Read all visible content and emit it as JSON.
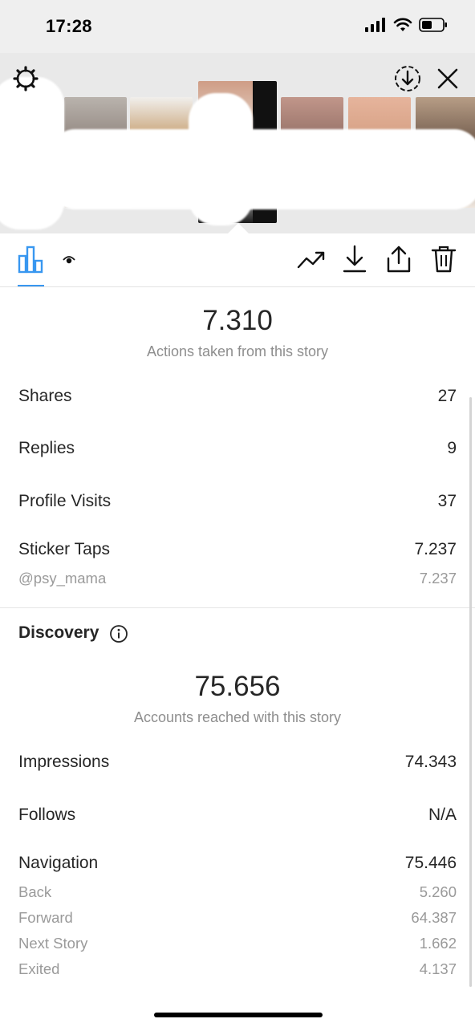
{
  "status_bar": {
    "time": "17:28",
    "icons": [
      "cellular-signal-icon",
      "wifi-icon",
      "battery-icon"
    ]
  },
  "story_strip": {
    "thumbnails": [
      "story-thumb-1",
      "story-thumb-2",
      "story-thumb-selected",
      "story-thumb-4",
      "story-thumb-5",
      "story-thumb-6"
    ],
    "settings_icon": "gear-icon",
    "download_icon": "download-circle-icon",
    "close_icon": "close-icon"
  },
  "toolbar": {
    "tabs": [
      "insights-bar-chart-icon",
      "viewers-eye-icon"
    ],
    "actions": [
      "promote-trend-icon",
      "save-download-icon",
      "share-icon",
      "delete-trash-icon"
    ],
    "accent": "#3897f0"
  },
  "interactions": {
    "total": "7.310",
    "caption": "Actions taken from this story",
    "rows": [
      {
        "label": "Shares",
        "value": "27"
      },
      {
        "label": "Replies",
        "value": "9"
      },
      {
        "label": "Profile Visits",
        "value": "37"
      },
      {
        "label": "Sticker Taps",
        "value": "7.237"
      }
    ],
    "sticker_sub": {
      "label": "@psy_mama",
      "value": "7.237"
    }
  },
  "discovery": {
    "title": "Discovery",
    "total": "75.656",
    "caption": "Accounts reached with this story",
    "rows": [
      {
        "label": "Impressions",
        "value": "74.343"
      },
      {
        "label": "Follows",
        "value": "N/A"
      },
      {
        "label": "Navigation",
        "value": "75.446"
      }
    ],
    "navigation_sub": [
      {
        "label": "Back",
        "value": "5.260"
      },
      {
        "label": "Forward",
        "value": "64.387"
      },
      {
        "label": "Next Story",
        "value": "1.662"
      },
      {
        "label": "Exited",
        "value": "4.137"
      }
    ]
  }
}
